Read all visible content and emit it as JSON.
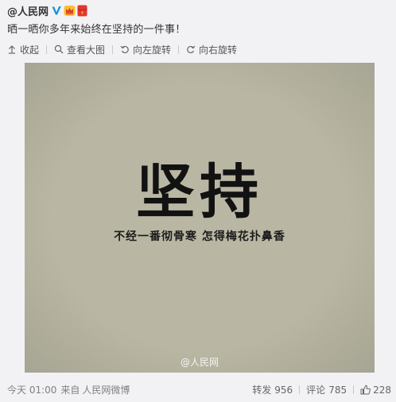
{
  "post": {
    "author": "@人民网",
    "text": "晒一晒你多年来始终在坚持的一件事！"
  },
  "toolbar": {
    "collapse": "收起",
    "view_large": "查看大图",
    "rotate_left": "向左旋转",
    "rotate_right": "向右旋转"
  },
  "image": {
    "title": "坚持",
    "subtitle": "不经一番彻骨寒 怎得梅花扑鼻香",
    "watermark": "@人民网",
    "background": "#b5b39e"
  },
  "footer": {
    "time": "今天 01:00",
    "from": "来自",
    "source": "人民网微博",
    "repost_label": "转发",
    "repost_count": "956",
    "comment_label": "评论",
    "comment_count": "785",
    "like_count": "228"
  },
  "icons": {
    "verified": "verified-v-icon",
    "badge1": "vip-crown-icon",
    "badge2": "red-envelope-icon",
    "collapse": "arrow-up-icon",
    "view_large": "magnifier-icon",
    "rotate_left": "rotate-left-icon",
    "rotate_right": "rotate-right-icon",
    "like": "thumbs-up-icon"
  },
  "colors": {
    "page_bg": "#f2f2f5",
    "verified_blue": "#1e8fe0",
    "badge_red": "#e2362e",
    "badge_gold": "#f0a90a"
  }
}
